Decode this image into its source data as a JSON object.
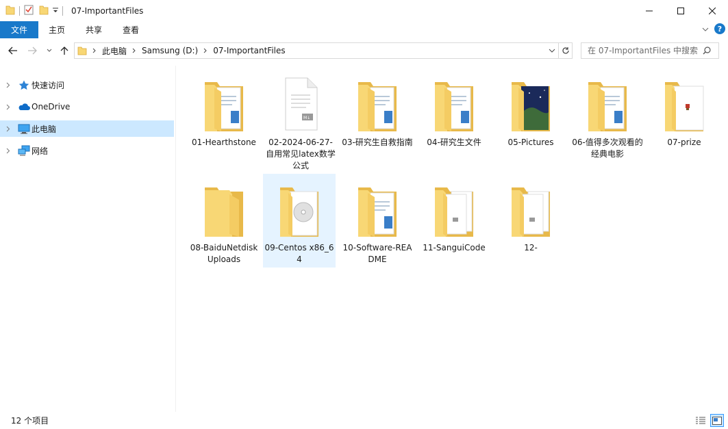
{
  "window": {
    "title": "07-ImportantFiles"
  },
  "ribbon": {
    "tabs": [
      "文件",
      "主页",
      "共享",
      "查看"
    ]
  },
  "address": {
    "crumbs": [
      "此电脑",
      "Samsung (D:)",
      "07-ImportantFiles"
    ],
    "search_placeholder": "在 07-ImportantFiles 中搜索"
  },
  "navpane": {
    "items": [
      {
        "label": "快速访问",
        "icon": "star-icon"
      },
      {
        "label": "OneDrive",
        "icon": "cloud-icon"
      },
      {
        "label": "此电脑",
        "icon": "computer-icon"
      },
      {
        "label": "网络",
        "icon": "network-icon"
      }
    ]
  },
  "files": [
    {
      "label": "01-Hearthstone",
      "kind": "folder-docs"
    },
    {
      "label": "02-2024-06-27-自用常见latex数学公式",
      "kind": "markdown-file"
    },
    {
      "label": "03-研究生自救指南",
      "kind": "folder-docs"
    },
    {
      "label": "04-研究生文件",
      "kind": "folder-docs"
    },
    {
      "label": "05-Pictures",
      "kind": "folder-picture"
    },
    {
      "label": "06-值得多次观看的经典电影",
      "kind": "folder-docs"
    },
    {
      "label": "07-prize",
      "kind": "folder-prize"
    },
    {
      "label": "08-BaiduNetdiskUploads",
      "kind": "folder-empty"
    },
    {
      "label": "09-Centos x86_64",
      "kind": "folder-disc"
    },
    {
      "label": "10-Software-README",
      "kind": "folder-docs"
    },
    {
      "label": "11-SanguiCode",
      "kind": "folder-docs2"
    },
    {
      "label": "12-",
      "kind": "folder-docs2"
    }
  ],
  "status": {
    "count": "12 个项目"
  },
  "colors": {
    "accent": "#1979ca",
    "selected_bg": "#cce8ff",
    "folder": "#f8d775",
    "folder_dark": "#e8b94a"
  }
}
